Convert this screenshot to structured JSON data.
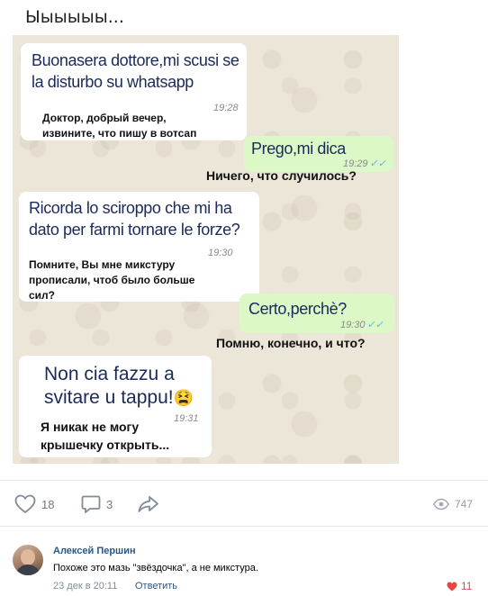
{
  "post": {
    "title": "Ыыыыыы..."
  },
  "chat": {
    "messages": [
      {
        "text_line1": "Buonasera dottore,mi scusi se",
        "text_line2": "la disturbo su whatsapp",
        "time": "19:28",
        "translation_line1": "Доктор, добрый вечер,",
        "translation_line2": "извините, что пишу в вотсап"
      },
      {
        "text": "Prego,mi dica",
        "time": "19:29",
        "translation": "Ничего, что случилось?"
      },
      {
        "text_line1": "Ricorda lo sciroppo che mi ha",
        "text_line2": "dato per farmi tornare le forze?",
        "time": "19:30",
        "translation_line1": "Помните, Вы мне микстуру",
        "translation_line2": "прописали, чтоб было больше",
        "translation_line3": "сил?"
      },
      {
        "text": "Certo,perchè?",
        "time": "19:30",
        "translation": "Помню, конечно, и что?"
      },
      {
        "text_line1": "Non cia fazzu a",
        "text_line2": "svitare u tappu!",
        "time": "19:31",
        "translation_line1": "Я никак не могу",
        "translation_line2": "крышечку открыть..."
      }
    ],
    "read_ticks": "✓✓",
    "emoji": "😫"
  },
  "actions": {
    "likes": "18",
    "comments": "3",
    "views": "747"
  },
  "comment": {
    "author": "Алексей Першин",
    "text": "Похоже это мазь \"звёздочка\", а не микстура.",
    "date": "23 дек в 20:11",
    "reply_label": "Ответить",
    "likes": "11"
  },
  "colors": {
    "link": "#2a5885",
    "outgoing_bubble": "#dcf8c6",
    "like_red": "#e64646",
    "action_gray": "#6f7985"
  }
}
